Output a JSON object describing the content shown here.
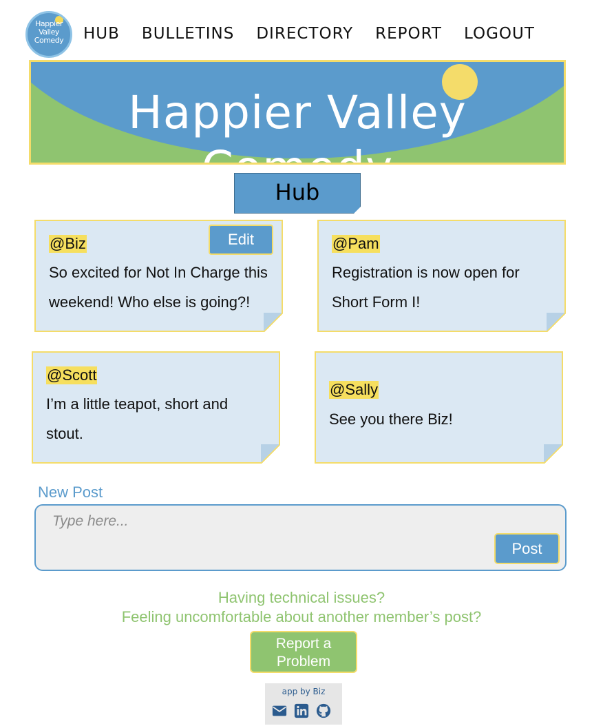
{
  "nav": {
    "logo_text": [
      "Happier",
      "Valley",
      "Comedy"
    ],
    "links": [
      "HUB",
      "BULLETINS",
      "DIRECTORY",
      "REPORT",
      "LOGOUT"
    ]
  },
  "banner": {
    "title": "Happier Valley Comedy"
  },
  "hub": {
    "title": "Hub"
  },
  "posts": [
    {
      "handle": "@Biz",
      "lines": [
        "So excited for Not In Charge this",
        "weekend! Who else is going?!"
      ],
      "edit_label": "Edit"
    },
    {
      "handle": "@Pam",
      "lines": [
        "Registration is now open for",
        "Short Form I!"
      ]
    },
    {
      "handle": "@Scott",
      "lines": [
        "I’m a little teapot, short and",
        "stout."
      ]
    },
    {
      "handle": "@Sally",
      "lines": [
        "See you there Biz!"
      ]
    }
  ],
  "new_post": {
    "label": "New Post",
    "placeholder": "Type here...",
    "button": "Post"
  },
  "footer": {
    "help_line1": "Having technical issues?",
    "help_line2": "Feeling uncomfortable about another member’s post?",
    "report_line1": "Report a",
    "report_line2": "Problem",
    "credit": "app by Biz",
    "icons": [
      "email-icon",
      "linkedin-icon",
      "github-icon"
    ]
  },
  "colors": {
    "blue": "#5b9bcc",
    "green": "#8fc470",
    "yellow": "#f4dc6a",
    "note_bg": "#dbe8f3"
  }
}
